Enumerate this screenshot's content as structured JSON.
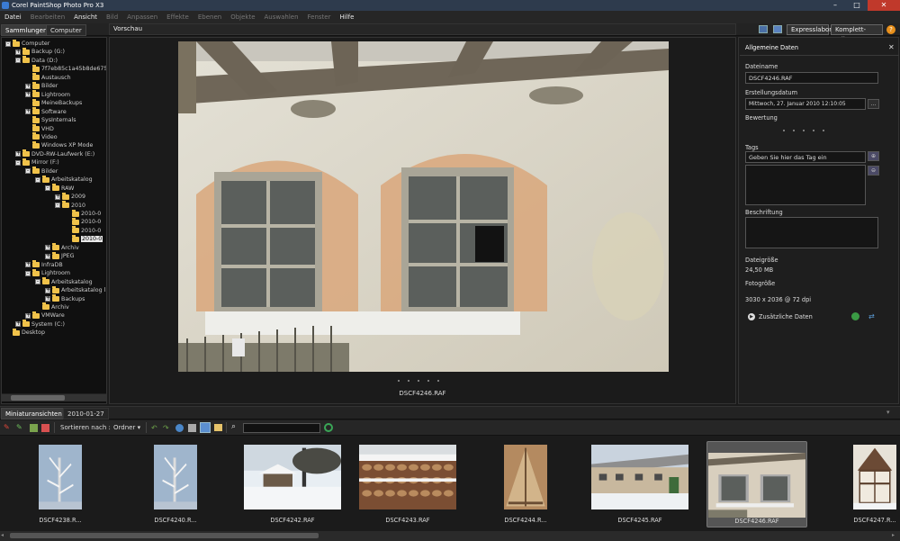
{
  "window": {
    "title": "Corel PaintShop Photo Pro X3"
  },
  "menu": [
    {
      "label": "Datei",
      "enabled": true
    },
    {
      "label": "Bearbeiten",
      "enabled": false
    },
    {
      "label": "Ansicht",
      "enabled": true
    },
    {
      "label": "Bild",
      "enabled": false
    },
    {
      "label": "Anpassen",
      "enabled": false
    },
    {
      "label": "Effekte",
      "enabled": false
    },
    {
      "label": "Ebenen",
      "enabled": false
    },
    {
      "label": "Objekte",
      "enabled": false
    },
    {
      "label": "Auswahlen",
      "enabled": false
    },
    {
      "label": "Fenster",
      "enabled": false
    },
    {
      "label": "Hilfe",
      "enabled": true
    }
  ],
  "toprow": {
    "tab_sammlungen": "Sammlungen",
    "tab_computer": "Computer",
    "preview_label": "Vorschau",
    "expresslabor": "Expresslabor",
    "komplett_editor": "Komplett-Editor"
  },
  "tree": [
    {
      "label": "Computer",
      "exp": "-"
    },
    {
      "label": "Backup (G:)",
      "exp": "+"
    },
    {
      "label": "Data (D:)",
      "exp": "-"
    },
    {
      "label": "7f7eb85c1a45b8de675",
      "exp": ""
    },
    {
      "label": "Austausch",
      "exp": ""
    },
    {
      "label": "Bilder",
      "exp": "+"
    },
    {
      "label": "Lightroom",
      "exp": "+"
    },
    {
      "label": "MeineBackups",
      "exp": ""
    },
    {
      "label": "Software",
      "exp": "+"
    },
    {
      "label": "SysInternals",
      "exp": ""
    },
    {
      "label": "VHD",
      "exp": ""
    },
    {
      "label": "Video",
      "exp": ""
    },
    {
      "label": "Windows XP Mode",
      "exp": ""
    },
    {
      "label": "DVD-RW-Laufwerk (E:)",
      "exp": "+"
    },
    {
      "label": "Mirror (F:)",
      "exp": "-"
    },
    {
      "label": "Bilder",
      "exp": "-"
    },
    {
      "label": "Arbeitskatalog",
      "exp": "-"
    },
    {
      "label": "RAW",
      "exp": "-"
    },
    {
      "label": "2009",
      "exp": "+"
    },
    {
      "label": "2010",
      "exp": "-"
    },
    {
      "label": "2010-0",
      "exp": ""
    },
    {
      "label": "2010-0",
      "exp": ""
    },
    {
      "label": "2010-0",
      "exp": ""
    },
    {
      "label": "2010-0",
      "exp": "",
      "selected": true
    },
    {
      "label": "Archiv",
      "exp": "+"
    },
    {
      "label": "JPEG",
      "exp": "+"
    },
    {
      "label": "InfraDB",
      "exp": "+"
    },
    {
      "label": "Lightroom",
      "exp": "-"
    },
    {
      "label": "Arbeitskatalog",
      "exp": "-"
    },
    {
      "label": "Arbeitskatalog l",
      "exp": "+"
    },
    {
      "label": "Backups",
      "exp": "+"
    },
    {
      "label": "Archiv",
      "exp": ""
    },
    {
      "label": "VMWare",
      "exp": "+"
    },
    {
      "label": "System (C:)",
      "exp": "+"
    },
    {
      "label": "Desktop",
      "exp": ""
    }
  ],
  "preview": {
    "caption": "DSCF4246.RAF"
  },
  "info": {
    "title": "Allgemeine Daten",
    "close": "✕",
    "dateiname_label": "Dateiname",
    "dateiname_value": "DSCF4246.RAF",
    "erstellungsdatum_label": "Erstellungsdatum",
    "erstellungsdatum_value": "Mittwoch, 27. Januar 2010 12:10:05",
    "date_button": "...",
    "bewertung_label": "Bewertung",
    "tags_label": "Tags",
    "tags_placeholder": "Geben Sie hier das Tag ein",
    "beschriftung_label": "Beschriftung",
    "dateigroesse_label": "Dateigröße",
    "dateigroesse_value": "24,50 MB",
    "fotogroesse_label": "Fotogröße",
    "fotogroesse_value": "3030 x 2036 @ 72 dpi",
    "zusaetzliche_daten": "Zusätzliche Daten"
  },
  "bottom": {
    "tab_miniaturansichten": "Miniaturansichten",
    "tab_date": "2010-01-27",
    "sortieren_label": "Sortieren nach :",
    "sortieren_value": "Ordner",
    "search_value": ""
  },
  "thumbnails": [
    {
      "caption": "DSCF4238.R...",
      "scene": "frost-tree"
    },
    {
      "caption": "DSCF4240.R...",
      "scene": "frost-tree"
    },
    {
      "caption": "DSCF4242.RAF",
      "scene": "snow-village"
    },
    {
      "caption": "DSCF4243.RAF",
      "scene": "woodpile"
    },
    {
      "caption": "DSCF4244.R...",
      "scene": "timber-wall"
    },
    {
      "caption": "DSCF4245.RAF",
      "scene": "farmhouse"
    },
    {
      "caption": "DSCF4246.RAF",
      "scene": "windows",
      "selected": true
    },
    {
      "caption": "DSCF4247.R...",
      "scene": "half-timber"
    }
  ]
}
